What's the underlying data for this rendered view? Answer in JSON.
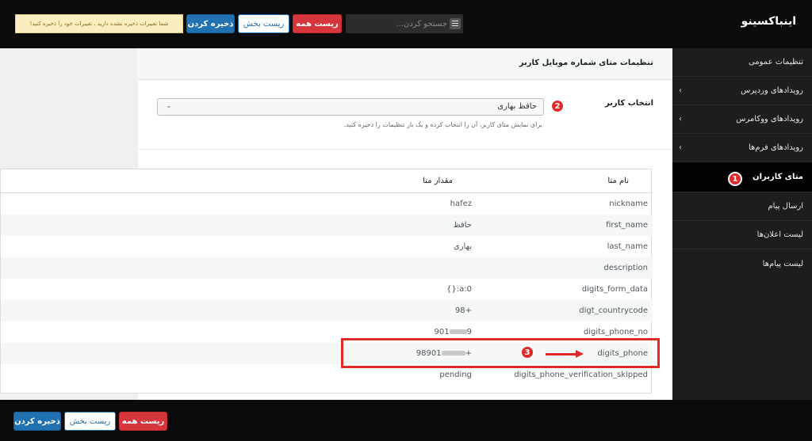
{
  "header": {
    "brand": "اینباکسینو",
    "search_placeholder": "جستجو کردن...",
    "reset_all": "ریست همه",
    "reset_section": "ریست بخش",
    "save": "ذخیره کردن",
    "notice": "شما تغییرات ذخیره نشده دارید ، تغییرات خود را ذخیره کنید!"
  },
  "sidebar": {
    "items": [
      {
        "label": "تنظیمات عمومی"
      },
      {
        "label": "رویدادهای وردپرس"
      },
      {
        "label": "رویدادهای ووکامرس"
      },
      {
        "label": "رویدادهای فرم‌ها"
      },
      {
        "label": "متای کاربران"
      },
      {
        "label": "ارسال پیام"
      },
      {
        "label": "لیست اعلان‌ها"
      },
      {
        "label": "لیست پیام‌ها"
      }
    ],
    "chevron": "‹"
  },
  "main": {
    "title": "تنظیمات متای شماره موبایل کاربر",
    "user_select": {
      "label": "انتخاب کاربر",
      "value": "حافظ بهاری",
      "description": "برای نمایش متای کاربر، آن را انتخاب کرده و یک بار تنظیمات را ذخیره کنید."
    }
  },
  "meta_table": {
    "headers": {
      "name": "نام متا",
      "value": "مقدار متا"
    },
    "rows": [
      {
        "name": "nickname",
        "value": "hafez"
      },
      {
        "name": "first_name",
        "value": "حافظ"
      },
      {
        "name": "last_name",
        "value": "بهاری"
      },
      {
        "name": "description",
        "value": ""
      },
      {
        "name": "digits_form_data",
        "value": "{}:a:0"
      },
      {
        "name": "digt_countrycode",
        "value": "98+"
      },
      {
        "name": "digits_phone_no",
        "value_prefix": "901",
        "value_suffix": "9"
      },
      {
        "name": "digits_phone",
        "value_prefix": "98901",
        "value_suffix": "+"
      },
      {
        "name": "digits_phone_verification_skipped",
        "value": "pending"
      }
    ]
  },
  "annotations": {
    "badge_1": "1",
    "badge_2": "2",
    "badge_3": "3",
    "color": "#e02a2a"
  },
  "footer": {
    "reset_all": "ریست همه",
    "reset_section": "ریست بخش",
    "save": "ذخیره کردن"
  }
}
